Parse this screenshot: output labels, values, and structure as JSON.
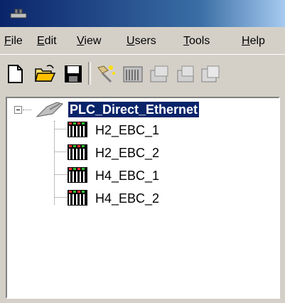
{
  "menu": {
    "items": [
      {
        "label": "File",
        "u": "F",
        "rest": "ile"
      },
      {
        "label": "Edit",
        "u": "E",
        "rest": "dit"
      },
      {
        "label": "View",
        "u": "V",
        "rest": "iew"
      },
      {
        "label": "Users",
        "u": "U",
        "rest": "sers"
      },
      {
        "label": "Tools",
        "u": "T",
        "rest": "ools"
      },
      {
        "label": "Help",
        "u": "H",
        "rest": "elp"
      }
    ]
  },
  "toolbar": {
    "buttons": [
      "new-icon",
      "open-folder-icon",
      "save-icon",
      "wand-icon",
      "plc-icon",
      "properties-icon",
      "properties-icon",
      "config-icon"
    ]
  },
  "tree": {
    "root": {
      "label": "PLC_Direct_Ethernet",
      "icon": "network-cable-icon"
    },
    "children": [
      {
        "label": "H2_EBC_1",
        "icon": "plc-rack-icon"
      },
      {
        "label": "H2_EBC_2",
        "icon": "plc-rack-icon"
      },
      {
        "label": "H4_EBC_1",
        "icon": "plc-rack-icon"
      },
      {
        "label": "H4_EBC_2",
        "icon": "plc-rack-icon"
      }
    ]
  },
  "colors": {
    "titlebar_start": "#0a246a",
    "titlebar_end": "#a6caf0",
    "selection": "#0a246a",
    "window_bg": "#d4d0c8"
  }
}
